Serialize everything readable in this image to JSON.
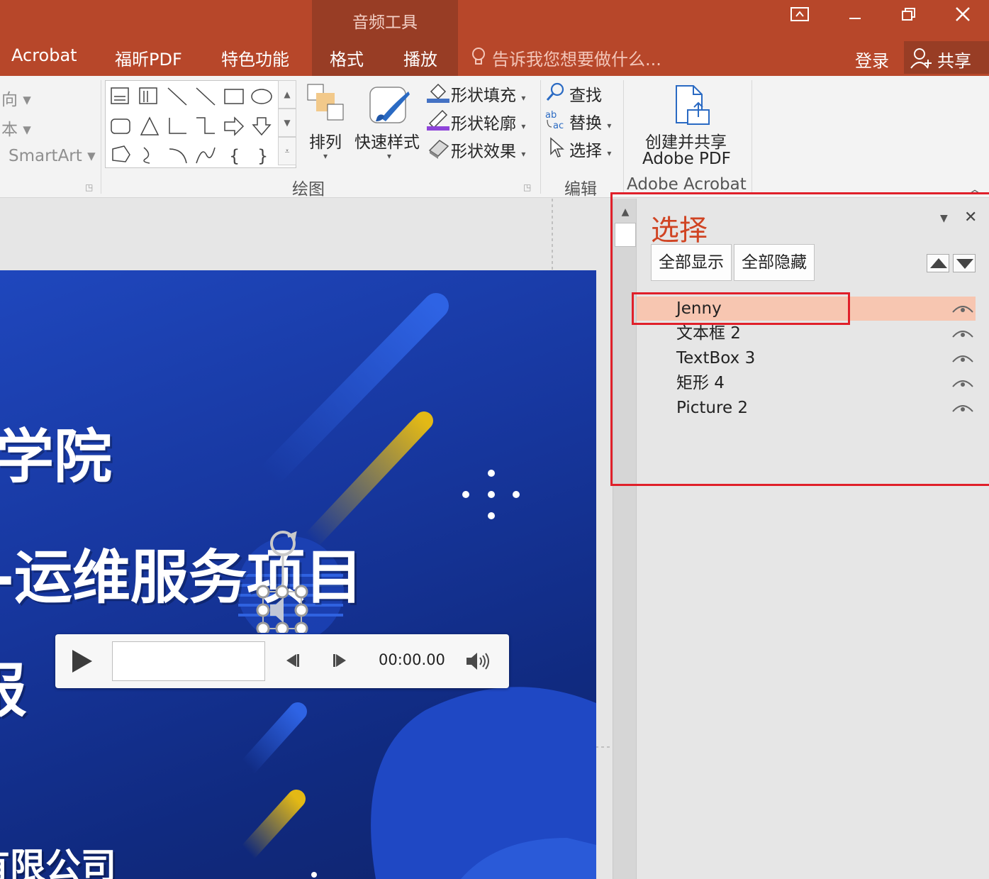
{
  "titlebar": {
    "context_tab_group": "音频工具",
    "tabs": [
      "Acrobat",
      "福昕PDF",
      "特色功能",
      "格式",
      "播放"
    ],
    "tell_me_placeholder": "告诉我您想要做什么...",
    "login_label": "登录",
    "share_label": "共享"
  },
  "ribbon": {
    "partial_left_items": [
      "向",
      "本",
      "SmartArt"
    ],
    "drawing_group_label": "绘图",
    "arrange_label": "排列",
    "quick_styles_label": "快速样式",
    "shape_fill_label": "形状填充",
    "shape_outline_label": "形状轮廓",
    "shape_effects_label": "形状效果",
    "find_label": "查找",
    "replace_label": "替换",
    "select_label": "选择",
    "editing_group_label": "编辑",
    "create_share_line1": "创建并共享",
    "create_share_line2": "Adobe PDF",
    "acrobat_group_label": "Adobe Acrobat",
    "gallery_text_glyph": "{",
    "gallery_text_glyph2": "}"
  },
  "slide": {
    "title_line1": "学院",
    "title_line2": "-运维服务项目",
    "title_line3": "报",
    "footer_text": "有限公司"
  },
  "audio_player": {
    "time": "00:00.00"
  },
  "selection_pane": {
    "title": "选择",
    "show_all_label": "全部显示",
    "hide_all_label": "全部隐藏",
    "objects": [
      {
        "name": "Jenny",
        "selected": true
      },
      {
        "name": "文本框 2",
        "selected": false
      },
      {
        "name": "TextBox 3",
        "selected": false
      },
      {
        "name": "矩形 4",
        "selected": false
      },
      {
        "name": "Picture 2",
        "selected": false
      }
    ]
  },
  "colors": {
    "ribbon_brand": "#b7472a",
    "context_tab": "#983d25",
    "pane_title": "#d04423",
    "selected_row": "#f7c6b1",
    "highlight_box": "#e0202a"
  }
}
